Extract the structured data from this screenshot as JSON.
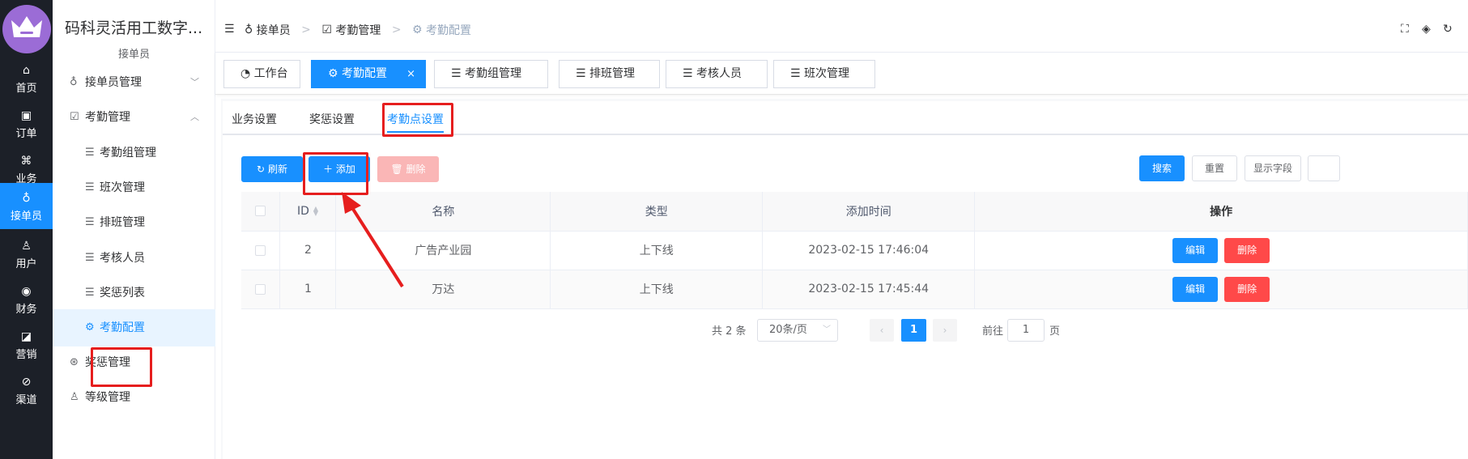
{
  "rail": {
    "items": [
      {
        "label": "首页",
        "icon": "home-icon"
      },
      {
        "label": "订单",
        "icon": "order-icon"
      },
      {
        "label": "业务",
        "icon": "command-icon"
      },
      {
        "label": "接单员",
        "icon": "bike-icon"
      },
      {
        "label": "用户",
        "icon": "user-icon"
      },
      {
        "label": "财务",
        "icon": "finance-icon"
      },
      {
        "label": "营销",
        "icon": "chart-icon"
      },
      {
        "label": "渠道",
        "icon": "compass-icon"
      }
    ],
    "active_index": 3,
    "active_color": "#1890ff",
    "logo_color": "#9b6cd6"
  },
  "sidebar": {
    "title": "码科灵活用工数字...",
    "subtitle": "接单员",
    "menus": [
      {
        "label": "接单员管理",
        "icon": "bike-icon",
        "arrow": "chevron-down-icon"
      },
      {
        "label": "考勤管理",
        "icon": "edit-icon",
        "arrow": "chevron-up-icon"
      },
      {
        "label": "考勤组管理",
        "icon": "list-icon"
      },
      {
        "label": "班次管理",
        "icon": "list-icon"
      },
      {
        "label": "排班管理",
        "icon": "list-icon"
      },
      {
        "label": "考核人员",
        "icon": "list-icon"
      },
      {
        "label": "奖惩列表",
        "icon": "list-icon"
      },
      {
        "label": "考勤配置",
        "icon": "settings-icon"
      },
      {
        "label": "奖惩管理",
        "icon": "medal-icon"
      },
      {
        "label": "等级管理",
        "icon": "user-level-icon"
      }
    ]
  },
  "header": {
    "breadcrumb": [
      "接单员",
      "考勤管理",
      "考勤配置"
    ]
  },
  "tags": [
    {
      "label": "工作台",
      "icon": "dashboard-icon"
    },
    {
      "label": "考勤配置",
      "icon": "settings-icon",
      "close": "×"
    },
    {
      "label": "考勤组管理",
      "icon": "list-icon"
    },
    {
      "label": "排班管理",
      "icon": "list-icon"
    },
    {
      "label": "考核人员",
      "icon": "list-icon"
    },
    {
      "label": "班次管理",
      "icon": "list-icon"
    }
  ],
  "subtabs": [
    "业务设置",
    "奖惩设置",
    "考勤点设置"
  ],
  "toolbar": {
    "refresh": "刷新",
    "add": "添加",
    "delete": "删除",
    "search": "搜索",
    "reset": "重置",
    "columns": "显示字段"
  },
  "table": {
    "headers": [
      "ID",
      "名称",
      "类型",
      "添加时间",
      "操作"
    ],
    "rows": [
      {
        "id": "2",
        "name": "广告产业园",
        "type": "上下线",
        "time": "2023-02-15 17:46:04"
      },
      {
        "id": "1",
        "name": "万达",
        "type": "上下线",
        "time": "2023-02-15 17:45:44"
      }
    ],
    "edit_label": "编辑",
    "delete_label": "删除"
  },
  "pagination": {
    "total": "共 2 条",
    "page_size": "20条/页",
    "current_page": "1",
    "goto_label": "前往",
    "goto_value": "1",
    "page_suffix": "页"
  }
}
